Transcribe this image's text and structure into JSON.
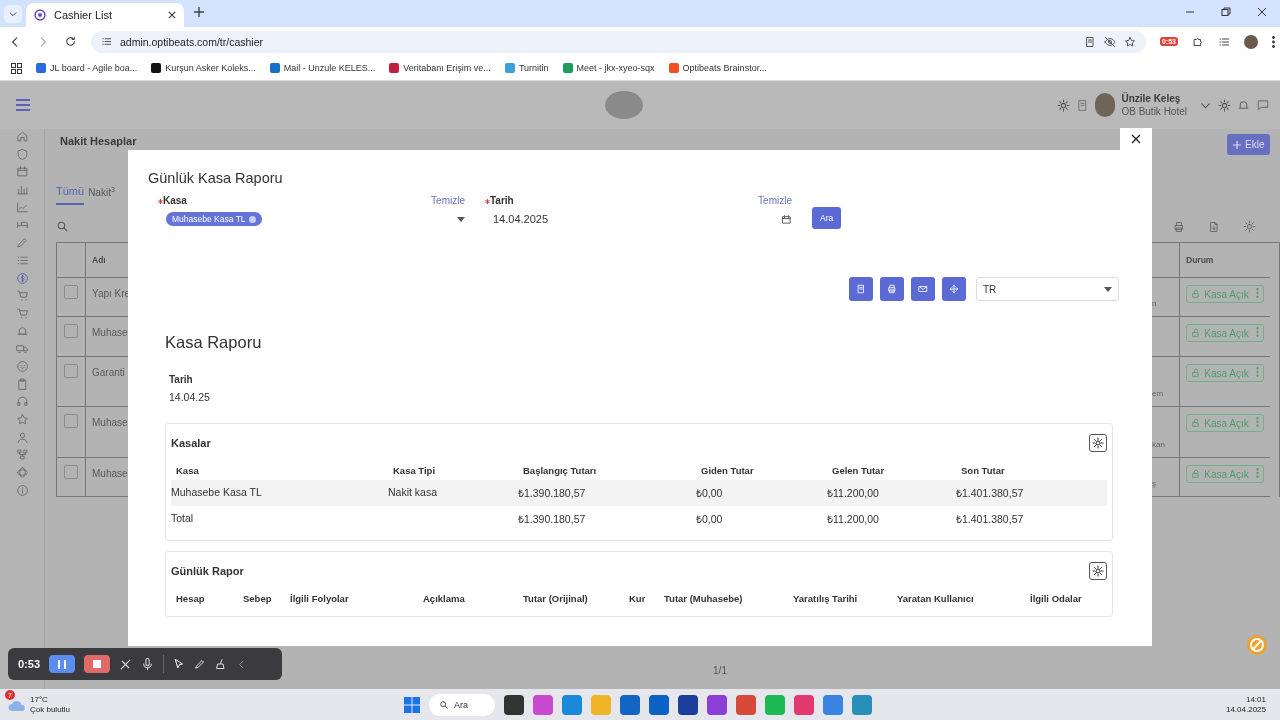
{
  "browser": {
    "tab_title": "Cashier List",
    "url": "admin.optibeats.com/tr/cashier",
    "extension_badge": "0:53",
    "bookmarks": [
      "JL board - Agile boa...",
      "Kurşun Asker Koleks...",
      "Mail - Unzule KELES...",
      "Veritabanı Erişim ve...",
      "Turnitin",
      "Meet - jkx-xyeo-sqx",
      "Optibeats Brainstor..."
    ]
  },
  "header": {
    "user_name": "Ünzile Keleş",
    "hotel": "OB Butik Hotel"
  },
  "sidebar": {
    "items": [
      {
        "selected": false
      },
      {
        "selected": false
      },
      {
        "selected": false
      },
      {
        "selected": false
      },
      {
        "selected": false
      },
      {
        "selected": false
      },
      {
        "selected": false
      },
      {
        "selected": false
      },
      {
        "selected": true
      },
      {
        "selected": false
      },
      {
        "selected": false
      },
      {
        "selected": false
      },
      {
        "selected": false
      },
      {
        "selected": false
      },
      {
        "selected": false
      },
      {
        "selected": false
      },
      {
        "selected": false
      },
      {
        "selected": false
      },
      {
        "selected": false
      },
      {
        "selected": false
      },
      {
        "selected": false
      }
    ]
  },
  "page": {
    "title": "Nakit Hesaplar",
    "add_button": "Ekle",
    "tabs": [
      {
        "label": "Tümü",
        "selected": true
      },
      {
        "label": "Nakit",
        "count": "3",
        "selected": false
      }
    ],
    "table": {
      "name_column": "Adı",
      "status_column": "Durum",
      "rows": [
        {
          "checked": false,
          "name": "Yapı Kre",
          "column_3": "n",
          "status": "Kasa Açık"
        },
        {
          "checked": false,
          "name": "Muhase",
          "status": "Kasa Açık"
        },
        {
          "checked": false,
          "name": "Garanti",
          "column_3": "em",
          "status": "Kasa Açık"
        },
        {
          "checked": false,
          "name": "Muhase",
          "column_3": "kan",
          "status": "Kasa Açık"
        },
        {
          "checked": false,
          "name": "Muhase",
          "column_3": "ş",
          "status": "Kasa Açık"
        }
      ]
    },
    "pager": "1/1"
  },
  "modal": {
    "title": "Günlük Kasa Raporu",
    "fields": [
      {
        "kind": "select",
        "label": "Kasa",
        "required": true,
        "clear": "Temizle",
        "chips": [
          "Muhasebe Kasa TL"
        ]
      },
      {
        "kind": "date",
        "label": "Tarih",
        "required": true,
        "clear": "Temizle",
        "value": "14.04.2025"
      }
    ],
    "search_button": "Ara",
    "language": "TR",
    "report": {
      "title": "Kasa Raporu",
      "date_label": "Tarih",
      "date": "14.04.25",
      "sections": [
        {
          "title": "Kasalar",
          "columns": [
            "Kasa",
            "Kasa Tipi",
            "Başlangıç Tutarı",
            "Giden Tutar",
            "Gelen Tutar",
            "Son Tutar"
          ],
          "rows": [
            [
              "Muhasebe Kasa TL",
              "Nakit kasa",
              "₺1.390.180,57",
              "₺0,00",
              "₺11.200,00",
              "₺1.401.380,57"
            ],
            [
              "Total",
              null,
              "₺1.390.180,57",
              "₺0,00",
              "₺11.200,00",
              "₺1.401.380,57"
            ]
          ]
        },
        {
          "title": "Günlük Rapor",
          "columns": [
            "Hesap",
            "Sebep",
            "İlgili Folyolar",
            "Açıklama",
            "Tutar (Orijinal)",
            "Kur",
            "Tutar (Muhasebe)",
            "Yaratılış Tarihi",
            "Yaratan Kullanıcı",
            "İlgili Odalar"
          ]
        }
      ]
    }
  },
  "recorder": {
    "time": "0:53"
  },
  "taskbar": {
    "weather_badge": "7",
    "temperature": "17°C",
    "weather": "Çok bulutlu",
    "search": "Ara",
    "time": "14:01",
    "date": "14.04.2025"
  }
}
